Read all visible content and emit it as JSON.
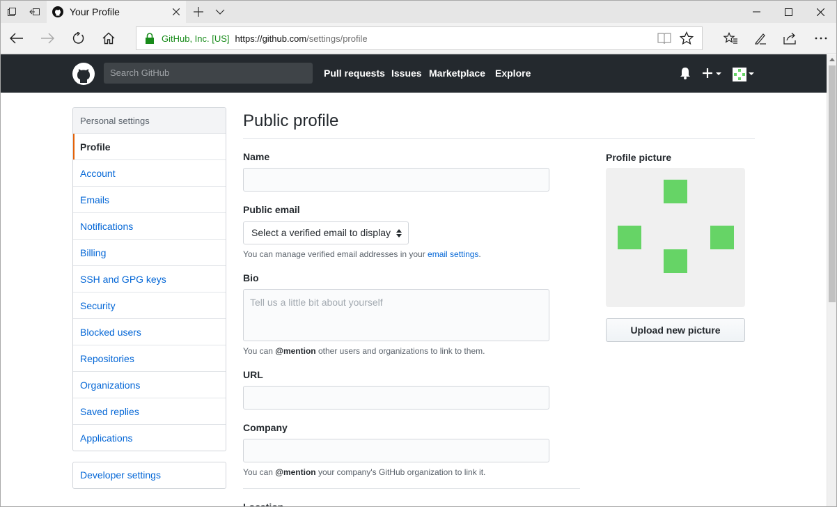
{
  "browser": {
    "tab_title": "Your Profile",
    "address": {
      "site_identity": "GitHub, Inc. [US]",
      "url_host": "https://github.com",
      "url_path": "/settings/profile"
    }
  },
  "header": {
    "search_placeholder": "Search GitHub",
    "nav": [
      "Pull requests",
      "Issues",
      "Marketplace",
      "Explore"
    ]
  },
  "sidebar": {
    "heading": "Personal settings",
    "items": [
      {
        "label": "Profile",
        "selected": true
      },
      {
        "label": "Account"
      },
      {
        "label": "Emails"
      },
      {
        "label": "Notifications"
      },
      {
        "label": "Billing"
      },
      {
        "label": "SSH and GPG keys"
      },
      {
        "label": "Security"
      },
      {
        "label": "Blocked users"
      },
      {
        "label": "Repositories"
      },
      {
        "label": "Organizations"
      },
      {
        "label": "Saved replies"
      },
      {
        "label": "Applications"
      }
    ],
    "developer_settings": "Developer settings"
  },
  "main": {
    "title": "Public profile",
    "name": {
      "label": "Name",
      "value": ""
    },
    "public_email": {
      "label": "Public email",
      "selected": "Select a verified email to display",
      "note_prefix": "You can manage verified email addresses in your ",
      "note_link": "email settings",
      "note_suffix": "."
    },
    "bio": {
      "label": "Bio",
      "placeholder": "Tell us a little bit about yourself",
      "note_prefix": "You can ",
      "note_bold": "@mention",
      "note_suffix": " other users and organizations to link to them."
    },
    "url": {
      "label": "URL",
      "value": ""
    },
    "company": {
      "label": "Company",
      "value": "",
      "note_prefix": "You can ",
      "note_bold": "@mention",
      "note_suffix": " your company's GitHub organization to link it."
    },
    "location": {
      "label": "Location"
    }
  },
  "profile_picture": {
    "label": "Profile picture",
    "upload_button": "Upload new picture"
  },
  "colors": {
    "header_bg": "#24292e",
    "link": "#0366d6",
    "selected_accent": "#e36209",
    "identicon": "#66d466",
    "secure_green": "#188b1a"
  }
}
